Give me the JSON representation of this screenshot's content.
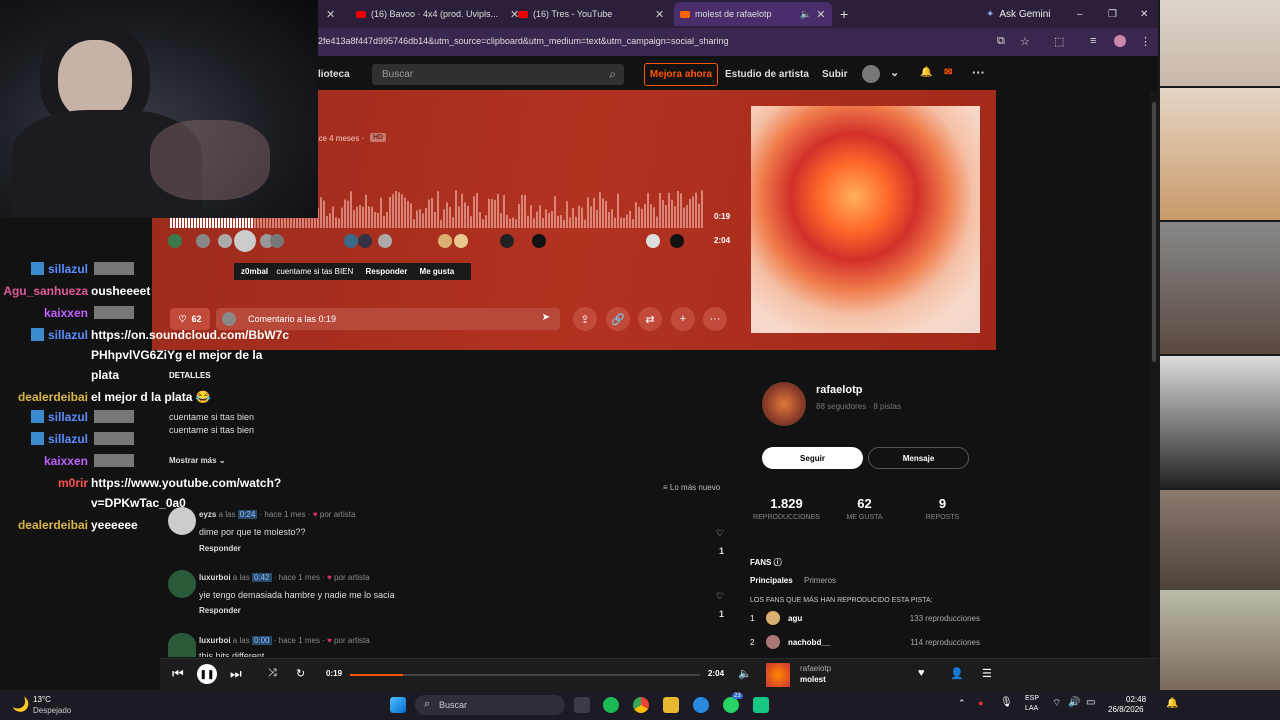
{
  "browser": {
    "tabs": [
      {
        "label": "(16) Bavoo · 4x4 (prod. Uvipls..."
      },
      {
        "label": "(16) Tres - YouTube"
      },
      {
        "label": "molest de rafaelotp"
      }
    ],
    "new_tab": "+",
    "ask_gemini": "Ask Gemini",
    "url": "2fe413a8f447d995746db14&utm_source=clipboard&utm_medium=text&utm_campaign=social_sharing",
    "win_min": "–",
    "win_max": "❐",
    "win_close": "✕"
  },
  "header": {
    "library": "lioteca",
    "search_placeholder": "Buscar",
    "upgrade": "Mejora ahora",
    "artist_studio": "Estudio de artista",
    "upload": "Subir"
  },
  "track": {
    "posted": "ace 4 meses ·",
    "quality": "HD",
    "time_current": "0:19",
    "time_total": "2:04",
    "comment_user": "z0mbal",
    "comment_text": "cuentame si tas BIEN",
    "reply": "Responder",
    "like": "Me gusta",
    "likes": "62",
    "comment_placeholder": "Comentario a las 0:19"
  },
  "details": {
    "heading": "DETALLES",
    "desc1": "cuentame si ttas bien",
    "desc2": "cuentame si ttas bien",
    "show_more": "Mostrar más",
    "sort": "Lo más nuevo",
    "comments": [
      {
        "user": "eyzs",
        "at": "a las",
        "ts": "0:24",
        "ago": "· hace 1 mes ·",
        "by": "por artista",
        "text": "dime por que te molesto??",
        "reply": "Responder",
        "likes": "1"
      },
      {
        "user": "luxurboi",
        "at": "a las",
        "ts": "0:42",
        "ago": "· hace 1 mes ·",
        "by": "por artista",
        "text": "yie tengo demasiada hambre y nadie me lo sacia",
        "reply": "Responder",
        "likes": "1"
      },
      {
        "user": "luxurboi",
        "at": "a las",
        "ts": "0:00",
        "ago": "· hace 1 mes ·",
        "by": "por artista",
        "text": "this hits different"
      }
    ]
  },
  "artist": {
    "name": "rafaelotp",
    "meta": "88 seguidores · 8 pistas",
    "follow": "Seguir",
    "message": "Mensaje",
    "stats": [
      {
        "value": "1.829",
        "label": "REPRODUCCIONES"
      },
      {
        "value": "62",
        "label": "ME GUSTA"
      },
      {
        "value": "9",
        "label": "REPOSTS"
      }
    ],
    "fans_title": "FANS",
    "fans_tabs": [
      "Principales",
      "Primeros"
    ],
    "fans_caption": "LOS FANS QUE MÁS HAN REPRODUCIDO ESTA PISTA:",
    "fans": [
      {
        "rank": "1",
        "name": "agu",
        "plays": "133 reproducciones"
      },
      {
        "rank": "2",
        "name": "nachobd__",
        "plays": "114 reproducciones"
      }
    ]
  },
  "chat": [
    {
      "user": "sillazul",
      "color": "#5b8cff",
      "text": "",
      "badge": true,
      "emote": true
    },
    {
      "user": "Agu_sanhueza",
      "color": "#e05a9a",
      "text": "ousheeeet"
    },
    {
      "user": "kaixxen",
      "color": "#c060ff",
      "text": "",
      "emote": true
    },
    {
      "user": "sillazul",
      "color": "#5b8cff",
      "text": "https://on.soundcloud.com/BbW7c",
      "badge": true
    },
    {
      "user": "",
      "color": "#fff",
      "text": "PHhpvlVG6ZiYg el mejor de la"
    },
    {
      "user": "",
      "color": "#fff",
      "text": "plata"
    },
    {
      "user": "dealerdeibai",
      "color": "#d9b64a",
      "text": "el mejor d la plata 😂"
    },
    {
      "user": "sillazul",
      "color": "#5b8cff",
      "text": "",
      "badge": true,
      "emote": true
    },
    {
      "user": "sillazul",
      "color": "#5b8cff",
      "text": "",
      "badge": true,
      "emote": true
    },
    {
      "user": "kaixxen",
      "color": "#c060ff",
      "text": "",
      "emote": true
    },
    {
      "user": "m0rir",
      "color": "#ff5050",
      "text": "https://www.youtube.com/watch?"
    },
    {
      "user": "",
      "color": "#fff",
      "text": "v=DPKwTac_0a0"
    },
    {
      "user": "dealerdeibai",
      "color": "#d9b64a",
      "text": "yeeeeee"
    }
  ],
  "player": {
    "current": "0:19",
    "total": "2:04",
    "progress": 0.15,
    "artist": "rafaelotp",
    "title": "molest"
  },
  "taskbar": {
    "weather_temp": "13°C",
    "weather_desc": "Despejado",
    "search": "Buscar",
    "lang1": "ESP",
    "lang2": "LAA",
    "time": "02:48",
    "date": "26/8/2026",
    "badge": "23"
  }
}
